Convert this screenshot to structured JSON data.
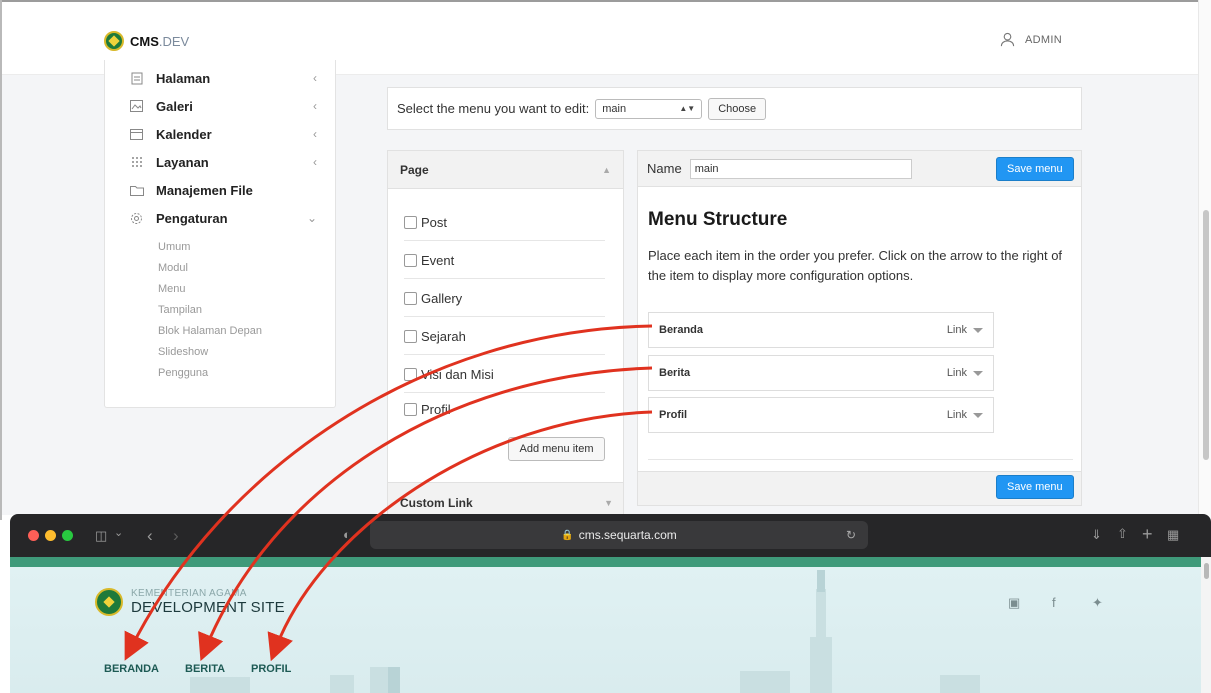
{
  "admin": {
    "brand": {
      "main": "CMS",
      "sub": ".DEV"
    },
    "user": "ADMIN",
    "sidebar": {
      "items": [
        {
          "label": "Halaman",
          "icon": "page-icon"
        },
        {
          "label": "Galeri",
          "icon": "gallery-icon"
        },
        {
          "label": "Kalender",
          "icon": "calendar-icon"
        },
        {
          "label": "Layanan",
          "icon": "grid-dots-icon"
        },
        {
          "label": "Manajemen File",
          "icon": "folder-icon"
        },
        {
          "label": "Pengaturan",
          "icon": "gear-icon"
        }
      ],
      "sub_items": [
        "Umum",
        "Modul",
        "Menu",
        "Tampilan",
        "Blok Halaman Depan",
        "Slideshow",
        "Pengguna"
      ]
    },
    "menu_select": {
      "label": "Select the menu you want to edit:",
      "value": "main",
      "button": "Choose"
    },
    "page_panel": {
      "title": "Page",
      "items": [
        "Post",
        "Event",
        "Gallery",
        "Sejarah",
        "Visi dan Misi",
        "Profil"
      ],
      "add_button": "Add menu item",
      "custom_link_title": "Custom Link"
    },
    "menu_panel": {
      "name_label": "Name",
      "name_value": "main",
      "save_label": "Save menu",
      "structure_title": "Menu Structure",
      "structure_desc": "Place each item in the order you prefer. Click on the arrow to the right of the item to display more configuration options.",
      "items": [
        {
          "title": "Beranda",
          "type": "Link"
        },
        {
          "title": "Berita",
          "type": "Link"
        },
        {
          "title": "Profil",
          "type": "Link"
        }
      ]
    }
  },
  "browser": {
    "url": "cms.sequarta.com"
  },
  "site": {
    "logo_small": "KEMENTERIAN AGAMA",
    "logo_big": "DEVELOPMENT SITE",
    "nav": [
      "BERANDA",
      "BERITA",
      "PROFIL"
    ]
  },
  "colors": {
    "accent_blue": "#2196f3",
    "arrow_red": "#e0321f",
    "site_green": "#3f9a7a",
    "browser_bar": "#262628"
  }
}
